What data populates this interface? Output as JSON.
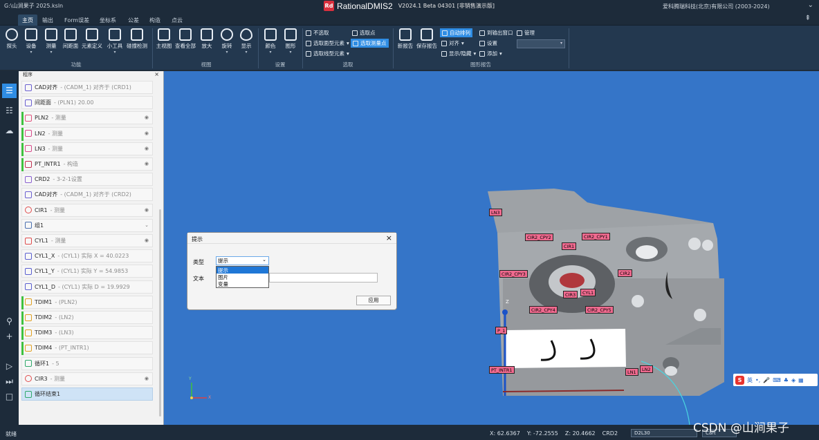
{
  "titlebar": {
    "path": "G:\\山涧果子 2025.ksln",
    "logo_text": "Rd",
    "app_name": "RationalDMIS2",
    "version": "V2024.1 Beta 04301 [非销售演示版]",
    "copyright": "爱科腾瑞科技(北京)有限公司 (2003-2024)"
  },
  "menubar": {
    "tabs": [
      "主页",
      "输出",
      "Form误差",
      "坐标系",
      "公差",
      "构造",
      "点云"
    ],
    "active_tab": "主页"
  },
  "ribbon": {
    "buttons": [
      {
        "label": "探头",
        "icon": "probe-icon"
      },
      {
        "label": "设备",
        "icon": "device-icon"
      },
      {
        "label": "测量",
        "icon": "measure-icon"
      },
      {
        "label": "间距面",
        "icon": "gap-plane-icon"
      },
      {
        "label": "元素定义",
        "icon": "feature-define-icon"
      },
      {
        "label": "小工具",
        "icon": "tools-icon"
      },
      {
        "label": "碰撞检测",
        "icon": "collision-icon"
      },
      {
        "label": "主视图",
        "icon": "home-view-icon"
      },
      {
        "label": "查看全部",
        "icon": "zoom-all-icon"
      },
      {
        "label": "放大",
        "icon": "zoom-in-icon"
      },
      {
        "label": "旋转",
        "icon": "rotate-icon"
      },
      {
        "label": "显示",
        "icon": "eye-icon"
      },
      {
        "label": "颜色",
        "icon": "color-icon"
      },
      {
        "label": "图形",
        "icon": "graphics-icon"
      },
      {
        "label": "新报告",
        "icon": "new-report-icon"
      },
      {
        "label": "保存报告",
        "icon": "save-report-icon"
      }
    ],
    "select_items": [
      "不选取",
      "选取面型元素",
      "选取线型元素",
      "选取点",
      "选取测量点"
    ],
    "report_items": [
      "自动排列",
      "对齐",
      "显示/隐藏",
      "到输出窗口",
      "设置",
      "添加",
      "管理"
    ],
    "groups": [
      "功能",
      "视图",
      "设置",
      "选取",
      "图形报告"
    ]
  },
  "panel": {
    "title": "程序",
    "items": [
      {
        "name": "CAD对齐",
        "detail": " - (CADM_1) 对齐于 (CRD1)",
        "bar": false,
        "eye": false,
        "icon": "cad-align-icon"
      },
      {
        "name": "间距面",
        "detail": " - (PLN1) 20.00",
        "bar": false,
        "eye": false,
        "icon": "gap-plane-icon"
      },
      {
        "name": "PLN2",
        "detail": " - 测量",
        "bar": true,
        "eye": true,
        "icon": "plane-icon"
      },
      {
        "name": "LN2",
        "detail": " - 测量",
        "bar": true,
        "eye": true,
        "icon": "line-icon"
      },
      {
        "name": "LN3",
        "detail": " - 测量",
        "bar": true,
        "eye": true,
        "icon": "line-icon"
      },
      {
        "name": "PT_INTR1",
        "detail": " - 构造",
        "bar": true,
        "eye": true,
        "icon": "point-icon"
      },
      {
        "name": "CRD2",
        "detail": " - 3-2-1设置",
        "bar": false,
        "eye": false,
        "icon": "coord-icon"
      },
      {
        "name": "CAD对齐",
        "detail": " - (CADM_1) 对齐于 (CRD2)",
        "bar": false,
        "eye": false,
        "icon": "cad-align-icon"
      },
      {
        "name": "CIR1",
        "detail": " - 测量",
        "bar": false,
        "eye": true,
        "icon": "circle-icon"
      },
      {
        "name": "组1",
        "detail": "",
        "bar": false,
        "eye": false,
        "icon": "group-icon"
      },
      {
        "name": "CYL1",
        "detail": " - 测量",
        "bar": false,
        "eye": true,
        "icon": "cylinder-icon"
      },
      {
        "name": "CYL1_X",
        "detail": " - (CYL1) 实际 X = 40.0223",
        "bar": false,
        "eye": false,
        "icon": "variable-icon"
      },
      {
        "name": "CYL1_Y",
        "detail": " - (CYL1) 实际 Y = 54.9853",
        "bar": false,
        "eye": false,
        "icon": "variable-icon"
      },
      {
        "name": "CYL1_D",
        "detail": " - (CYL1) 实际 D = 19.9929",
        "bar": false,
        "eye": false,
        "icon": "variable-icon"
      },
      {
        "name": "TDIM1",
        "detail": " - (PLN2)",
        "bar": true,
        "eye": false,
        "icon": "tolerance-icon"
      },
      {
        "name": "TDIM2",
        "detail": " - (LN2)",
        "bar": true,
        "eye": false,
        "icon": "tolerance-icon"
      },
      {
        "name": "TDIM3",
        "detail": " - (LN3)",
        "bar": true,
        "eye": false,
        "icon": "tolerance-icon"
      },
      {
        "name": "TDIM4",
        "detail": " - (PT_INTR1)",
        "bar": true,
        "eye": false,
        "icon": "tolerance-icon"
      },
      {
        "name": "循环1",
        "detail": " - 5",
        "bar": false,
        "eye": false,
        "icon": "loop-icon"
      },
      {
        "name": "CIR3",
        "detail": " - 测量",
        "bar": false,
        "eye": true,
        "icon": "circle-icon"
      },
      {
        "name": "循环结束1",
        "detail": "",
        "bar": false,
        "eye": false,
        "icon": "loop-end-icon"
      }
    ]
  },
  "dialog": {
    "title": "提示",
    "type_label": "类型",
    "text_label": "文本",
    "selected": "提示",
    "options": [
      "提示",
      "图片",
      "变量"
    ],
    "apply_label": "应用"
  },
  "viewport": {
    "labels": [
      "LN3",
      "CIR2_CPY2",
      "CIR2_CPY1",
      "CIR1",
      "CIR2_CPY3",
      "CIR2",
      "CIR3",
      "CYL1",
      "CIR2_CPY4",
      "CIR2_CPY5",
      "P_1",
      "PT_INTR1",
      "LN1",
      "LN2"
    ],
    "axis_z": "Z",
    "triad_y": "Y",
    "triad_x": "X",
    "label_color": "#f06a8f",
    "background": "#3575c8"
  },
  "ime": {
    "logo": "S",
    "lang": "英"
  },
  "statusbar": {
    "ready": "就绪",
    "x": "X: 62.6367",
    "y": "Y: -72.2555",
    "z": "Z: 20.4662",
    "crd": "CRD2",
    "probe": "D2L30",
    "mode": "Cart"
  },
  "watermark": "CSDN @山涧果子"
}
